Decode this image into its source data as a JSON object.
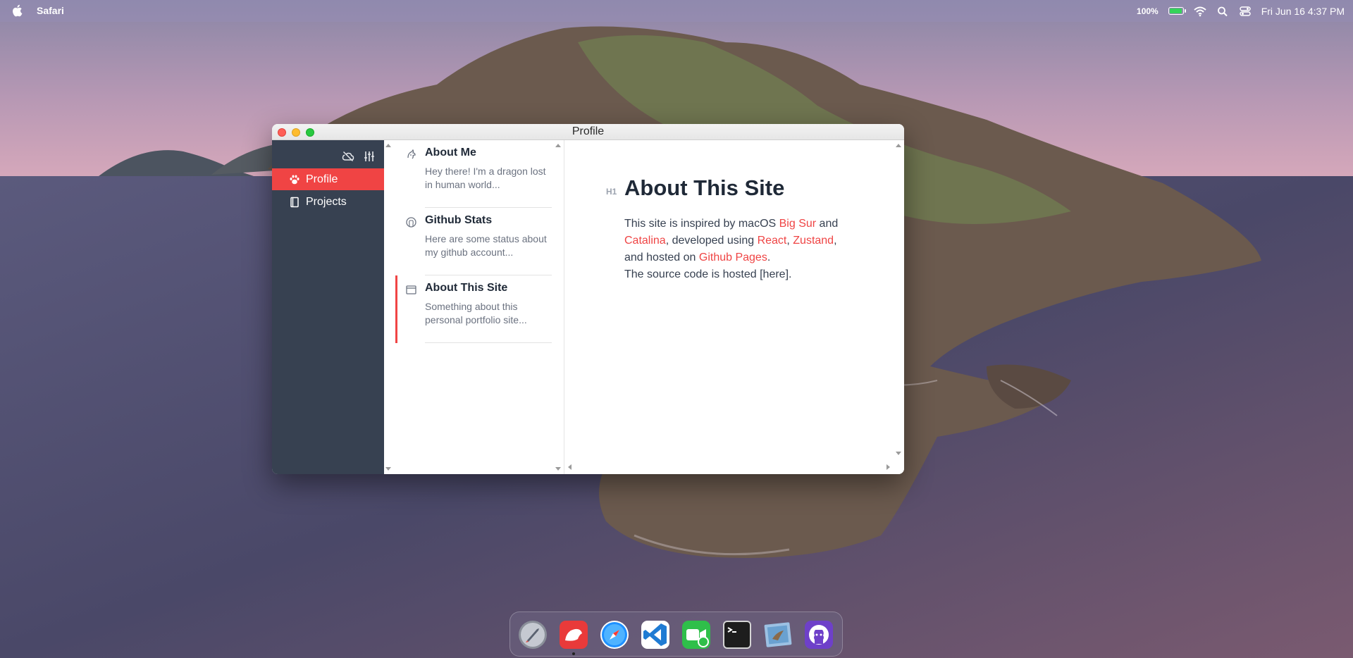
{
  "menubar": {
    "app_name": "Safari",
    "battery_percent": "100%",
    "battery_level": 1.0,
    "clock": "Fri Jun 16 4:37 PM",
    "icons": [
      "apple-icon",
      "battery-icon",
      "wifi-icon",
      "search-icon",
      "control-center-icon"
    ]
  },
  "window": {
    "title": "Profile"
  },
  "sidebar": {
    "tools": [
      "cloud-off-icon",
      "sliders-icon"
    ],
    "items": [
      {
        "label": "Profile",
        "icon": "paw-icon",
        "active": true
      },
      {
        "label": "Projects",
        "icon": "book-icon",
        "active": false
      }
    ]
  },
  "notes": [
    {
      "title": "About Me",
      "excerpt": "Hey there! I'm a dragon lost in human world...",
      "icon": "dragon-icon",
      "selected": false
    },
    {
      "title": "Github Stats",
      "excerpt": "Here are some status about my github account...",
      "icon": "github-icon",
      "selected": false
    },
    {
      "title": "About This Site",
      "excerpt": "Something about this personal portfolio site...",
      "icon": "window-icon",
      "selected": true
    }
  ],
  "content": {
    "heading_tag": "H1",
    "heading": "About This Site",
    "p1": {
      "t1": "This site is inspired by macOS ",
      "l1": "Big Sur",
      "t2": " and ",
      "l2": "Catalina",
      "t3": ", developed using ",
      "l3": "React",
      "t4": ", ",
      "l4": "Zustand",
      "t5": ", and hosted on ",
      "l5": "Github Pages",
      "t6": "."
    },
    "p2": "The source code is hosted [here].",
    "link_color": "#ef4444"
  },
  "dock": {
    "apps": [
      "launchpad-icon",
      "bear-notes-icon",
      "safari-icon",
      "vscode-icon",
      "facetime-icon",
      "terminal-icon",
      "mail-icon",
      "github-icon"
    ]
  },
  "colors": {
    "accent": "#f04444",
    "sidebar_bg": "#374151"
  }
}
